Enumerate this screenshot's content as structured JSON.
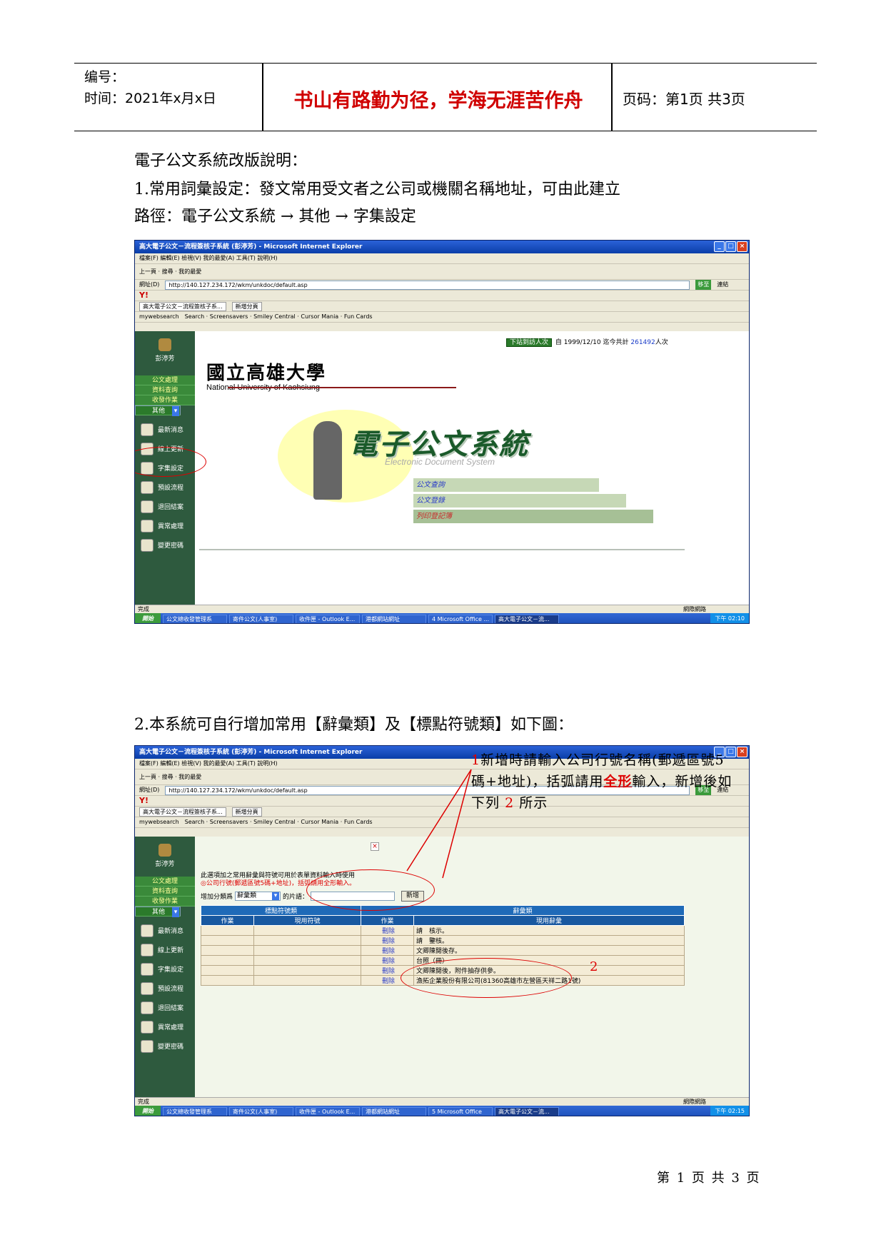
{
  "header": {
    "number_label": "编号：",
    "time_label": "时间：2021年x月x日",
    "motto": "书山有路勤为径，学海无涯苦作舟",
    "page_info": "页码：第1页 共3页"
  },
  "intro": {
    "title": "電子公文系統改版說明：",
    "item1": "1.常用詞彙設定：發文常用受文者之公司或機關名稱地址，可由此建立",
    "path": "路徑：電子公文系統 → 其他 → 字集設定",
    "item2": "2.本系統可自行增加常用【辭彙類】及【標點符號類】如下圖："
  },
  "browser": {
    "title": "高大電子公文－流程簽核子系統 (彭渟芳) - Microsoft Internet Explorer",
    "menu": "檔案(F)  編輯(E)  檢視(V)  我的最愛(A)  工具(T)  說明(H)",
    "nav": "上一頁 · 搜尋 · 我的最愛",
    "address_label": "網址(D)",
    "address1": "http://140.127.234.172/wkm/unkdoc/default.asp",
    "address2": "http://140.127.234.172/wkm/unkdoc/default.asp",
    "go_label": "移至",
    "links_label": "連結",
    "yahoo": "Y!",
    "tab_label": "高大電子公文－流程簽核子系...",
    "new_tab": "新增分頁",
    "mywebsearch": "mywebsearch",
    "search_tools": "Search · Screensavers · Smiley Central · Cursor Mania · Fun Cards",
    "status_done": "完成",
    "status_zone": "網際網路",
    "start": "開始",
    "tasks": [
      "公文總收發管理系",
      "寄件公文(人事室)",
      "收件匣 - Outlook E...",
      "港都網站網址",
      "4 Microsoft Office ...",
      "高大電子公文－流..."
    ],
    "tasks2": [
      "公文總收發管理系",
      "寄件公文(人事室)",
      "收件匣 - Outlook E...",
      "港都網站網址",
      "5 Microsoft Office",
      "高大電子公文－流..."
    ],
    "clock1": "下午 02:10",
    "clock2": "下午 02:15"
  },
  "app": {
    "user": "彭渟芳",
    "green_menu": [
      "公文處理",
      "資料查詢",
      "收發作業",
      "其他"
    ],
    "side_menu": [
      "最新消息",
      "線上更新",
      "字集設定",
      "預設流程",
      "退回結案",
      "異常處理",
      "變更密碼"
    ],
    "visit_badge": "下站到訪人次",
    "visit_text": "自 1999/12/10 迄今共計",
    "visit_count": "261492",
    "visit_unit": "人次",
    "uni_zh": "國立高雄大學",
    "uni_en": "National University of Kaohsiung",
    "system_zh": "電子公文系統",
    "system_en": "Electronic  Document  System",
    "menu_links": [
      "公文查詢",
      "公文登錄",
      "列印登記簿"
    ]
  },
  "words_page": {
    "notice_line1": "此選項加之常用辭彙與符號可用於表單資料輸入時使用",
    "notice_line2": "◎公司行號(郵遞區號5碼+地址)，括弧請用全形輸入。",
    "add_label": "增加分類爲",
    "select_value": "辭彙類",
    "phrase_label": "的片語：",
    "add_button": "新增",
    "group_punct": "標點符號類",
    "group_words": "辭彙類",
    "col_action": "作業",
    "col_symbol": "現用符號",
    "col_action2": "作業",
    "col_word": "現用辭彙",
    "delete_label": "刪除",
    "rows": [
      "請　核示。",
      "請　鑒核。",
      "文卿陳閱後存。",
      "台照（冊）",
      "文卿陳閱後，附件抽存供參。",
      "漁拓企業股份有限公司(81360高雄市左營區天祥二路1號)"
    ]
  },
  "annotation": {
    "n1": "1",
    "line1": "新增時請輸入公司行號名稱(郵遞區號5",
    "line2a": "碼+地址)，括弧請用",
    "line2b": "全形",
    "line2c": "輸入，新增後如",
    "line3a": "下列",
    "n2": "2",
    "line3b": "所示",
    "marker2": "2"
  },
  "footer": "第 1 页 共 3 页"
}
